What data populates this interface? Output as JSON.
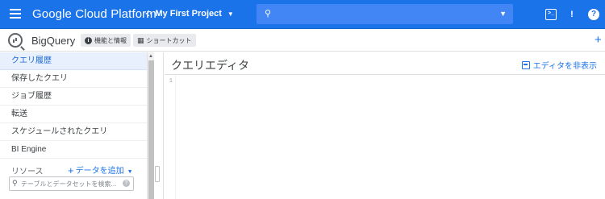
{
  "topbar": {
    "title": "Google Cloud Platform",
    "project": "My First Project",
    "search_value": "",
    "search_placeholder": "",
    "accent": "#1a73e8",
    "icons": [
      "menu-icon",
      "project-icon",
      "search-icon",
      "dropdown-icon",
      "cloud-shell-icon",
      "notifications-icon",
      "help-icon"
    ]
  },
  "appbar": {
    "product": "BigQuery",
    "info_chip": "機能と情報",
    "shortcut_chip": "ショートカット",
    "add_symbol": "+"
  },
  "sidebar": {
    "items": [
      {
        "label": "クエリ履歴",
        "active": true
      },
      {
        "label": "保存したクエリ",
        "active": false
      },
      {
        "label": "ジョブ履歴",
        "active": false
      },
      {
        "label": "転送",
        "active": false
      },
      {
        "label": "スケジュールされたクエリ",
        "active": false
      },
      {
        "label": "BI Engine",
        "active": false
      }
    ],
    "resources_label": "リソース",
    "add_data_label": "データを追加",
    "search_placeholder": "テーブルとデータセットを検索...",
    "search_value": ""
  },
  "editor": {
    "title": "クエリエディタ",
    "hide_label": "エディタを非表示",
    "line_numbers": [
      "1"
    ],
    "content": ""
  }
}
